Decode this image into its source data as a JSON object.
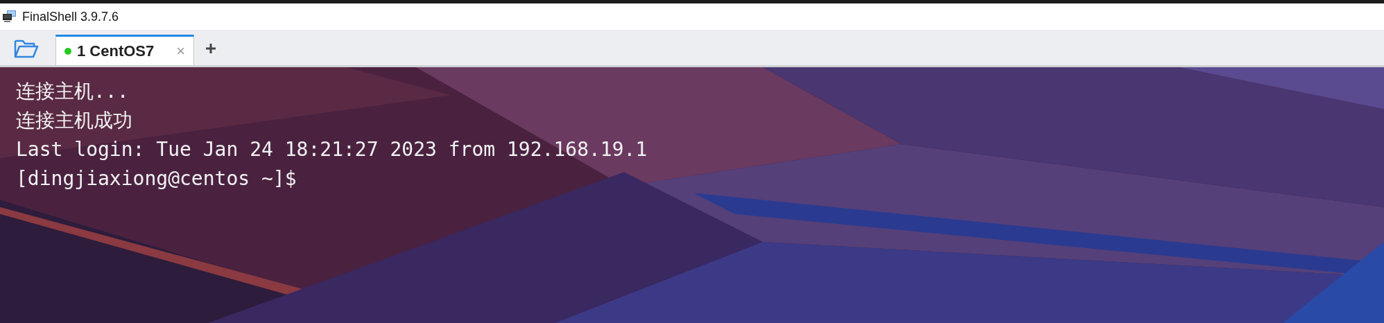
{
  "window": {
    "title": "FinalShell 3.9.7.6"
  },
  "tabs": [
    {
      "label": "1 CentOS7",
      "selected": true,
      "connected": true,
      "close": "×"
    }
  ],
  "terminal": {
    "lines": [
      "连接主机...",
      "连接主机成功",
      "Last login: Tue Jan 24 18:21:27 2023 from 192.168.19.1",
      "[dingjiaxiong@centos ~]$"
    ]
  }
}
